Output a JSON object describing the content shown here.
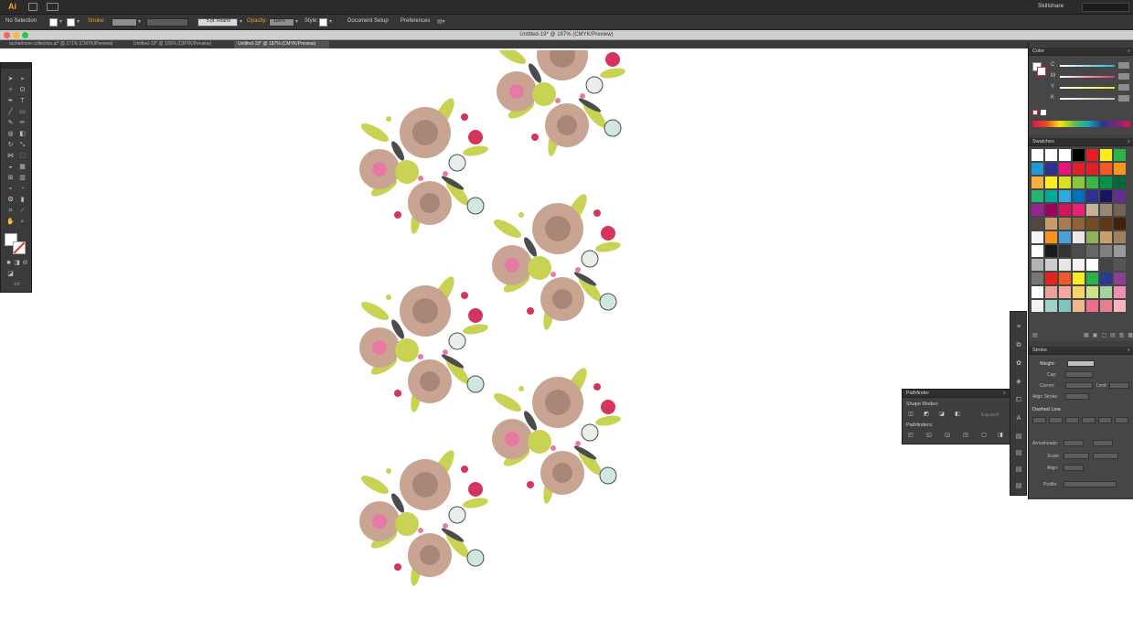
{
  "app": {
    "logo": "Ai",
    "workspace": "Skillshare"
  },
  "control_bar": {
    "selection_label": "No Selection",
    "stroke_label": "Stroke:",
    "style_dropdown": "5 pt. Round",
    "opacity_label": "Opacity:",
    "opacity_value": "100%",
    "style_label": "Style:",
    "document_setup": "Document Setup",
    "preferences": "Preferences"
  },
  "document": {
    "title": "Untitled-19* @ 187% (CMYK/Preview)",
    "tabs": [
      {
        "label": "rachelmore collection.ai* @ 171% (CMYK/Preview)",
        "active": false
      },
      {
        "label": "Untitled-19* @ 100% (CMYK/Preview)",
        "active": false
      },
      {
        "label": "Untitled-19* @ 187% (CMYK/Preview)",
        "active": true
      }
    ]
  },
  "panels": {
    "color": {
      "title": "Color",
      "channels": [
        "C",
        "M",
        "Y",
        "K"
      ],
      "channel_colors": [
        "#1fb6d8",
        "#e0347c",
        "#f2e41c",
        "#bdbdbd"
      ],
      "units": "%"
    },
    "swatches": {
      "title": "Swatches",
      "colors": [
        "#ffffff",
        "#ffffff",
        "#ffffff",
        "#000000",
        "#e31e24",
        "#f8ed1f",
        "#2db34a",
        "#1b9ad6",
        "#2e3192",
        "#e6177a",
        "#e31e24",
        "#e31e24",
        "#f15a24",
        "#f7941d",
        "#fbb03b",
        "#fcee21",
        "#d9e021",
        "#8cc63f",
        "#39b54a",
        "#009245",
        "#006837",
        "#22b573",
        "#00a99d",
        "#29abe2",
        "#0071bc",
        "#2e3192",
        "#1b1464",
        "#662d91",
        "#93278f",
        "#9e005d",
        "#d4145a",
        "#ed1e79",
        "#c7b299",
        "#998675",
        "#736357",
        "#534741",
        "#c69c6d",
        "#a67c52",
        "#8c6239",
        "#754c24",
        "#603813",
        "#42210b",
        "#f5f5f5",
        "#f7931e",
        "#4d9ed8",
        "#e8e8e8",
        "#8fb35a",
        "#c6a06a",
        "#a08060",
        "#ffffff",
        "#1a1a1a",
        "#333333",
        "#4d4d4d",
        "#666666",
        "#808080",
        "#999999",
        "#b3b3b3",
        "#cccccc",
        "#e6e6e6",
        "#f2f2f2",
        "#ffffff",
        "#444444",
        "#555555",
        "#777777",
        "#e3241d",
        "#f05a28",
        "#f6ec22",
        "#2bb34b",
        "#2b3990",
        "#8b3f96",
        "#ffffff",
        "#e7a39a",
        "#f3a9a0",
        "#f7d36b",
        "#cde38a",
        "#a5d29f",
        "#ee8fb2",
        "#f2f2f2",
        "#9fd1c8",
        "#7fc4c0",
        "#f0b88b",
        "#f06d8c",
        "#e57f8e",
        "#f8b3c0"
      ]
    },
    "stroke": {
      "title": "Stroke",
      "weight_label": "Weight:",
      "cap_label": "Cap:",
      "corner_label": "Corner:",
      "limit_label": "Limit:",
      "align_label": "Align Stroke:",
      "dashed_line_label": "Dashed Line",
      "dash_labels": [
        "dash",
        "gap",
        "dash",
        "gap",
        "dash",
        "gap"
      ],
      "arrowheads_label": "Arrowheads:",
      "scale_label": "Scale:",
      "align_label2": "Align:",
      "profile_label": "Profile:"
    },
    "pathfinder": {
      "title": "Pathfinder",
      "shape_modes": "Shape Modes:",
      "pathfinders": "Pathfinders:",
      "expand": "Expand"
    }
  },
  "artwork": {
    "colors": {
      "petal_blush": "#c9a493",
      "petal_center": "#a98777",
      "leaf_green": "#c8d253",
      "magenta": "#d6345c",
      "dark_leaf": "#4c4c4f",
      "mint": "#cfe7df",
      "pink_center": "#e77aa4"
    }
  }
}
